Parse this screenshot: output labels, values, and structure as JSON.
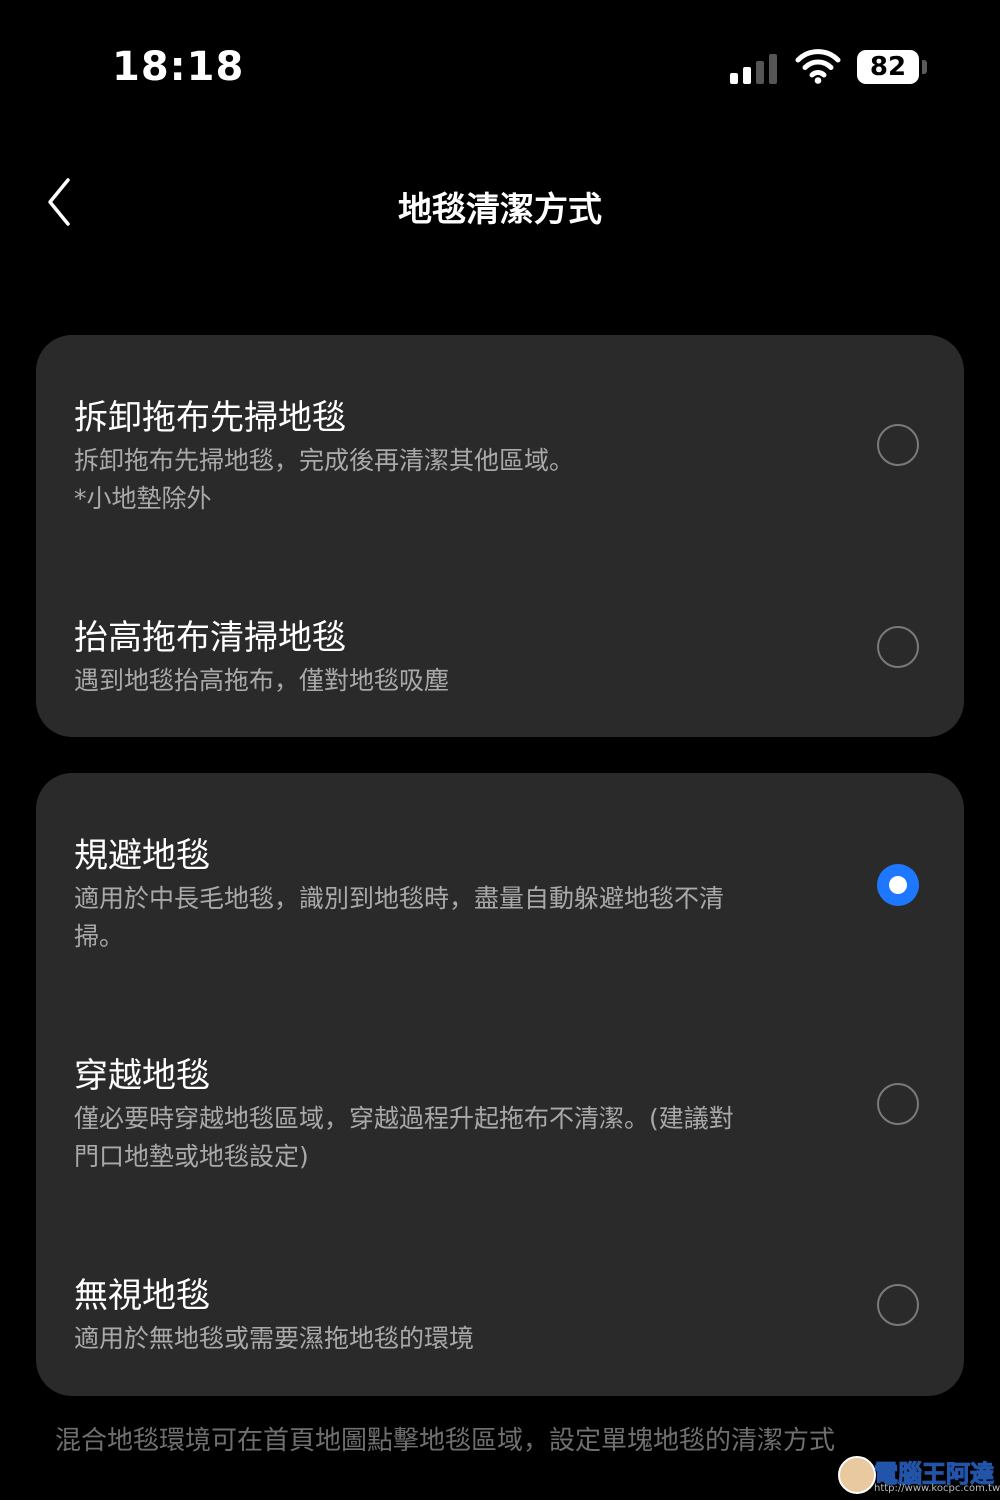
{
  "status": {
    "time": "18:18",
    "battery": "82"
  },
  "header": {
    "title": "地毯清潔方式"
  },
  "groups": [
    {
      "options": [
        {
          "title": "拆卸拖布先掃地毯",
          "desc_lines": [
            "拆卸拖布先掃地毯，完成後再清潔其他區域。",
            "*小地墊除外"
          ],
          "selected": false
        },
        {
          "title": "抬高拖布清掃地毯",
          "desc_lines": [
            "遇到地毯抬高拖布，僅對地毯吸塵"
          ],
          "selected": false
        }
      ]
    },
    {
      "options": [
        {
          "title": "規避地毯",
          "desc_lines": [
            "適用於中長毛地毯，識別到地毯時，盡量自動躲避地毯不清",
            "掃。"
          ],
          "selected": true
        },
        {
          "title": "穿越地毯",
          "desc_lines": [
            "僅必要時穿越地毯區域，穿越過程升起拖布不清潔。(建議對",
            "門口地墊或地毯設定)"
          ],
          "selected": false
        },
        {
          "title": "無視地毯",
          "desc_lines": [
            "適用於無地毯或需要濕拖地毯的環境"
          ],
          "selected": false
        }
      ]
    }
  ],
  "footer": {
    "note": "混合地毯環境可在首頁地圖點擊地毯區域，設定單塊地毯的清潔方式"
  },
  "watermark": {
    "text": "電腦王阿達",
    "url": "http://www.kocpc.com.tw"
  },
  "colors": {
    "background": "#000000",
    "card": "#2a2a2a",
    "accent": "#1e78ff",
    "secondary_text": "#a9a9a9"
  }
}
